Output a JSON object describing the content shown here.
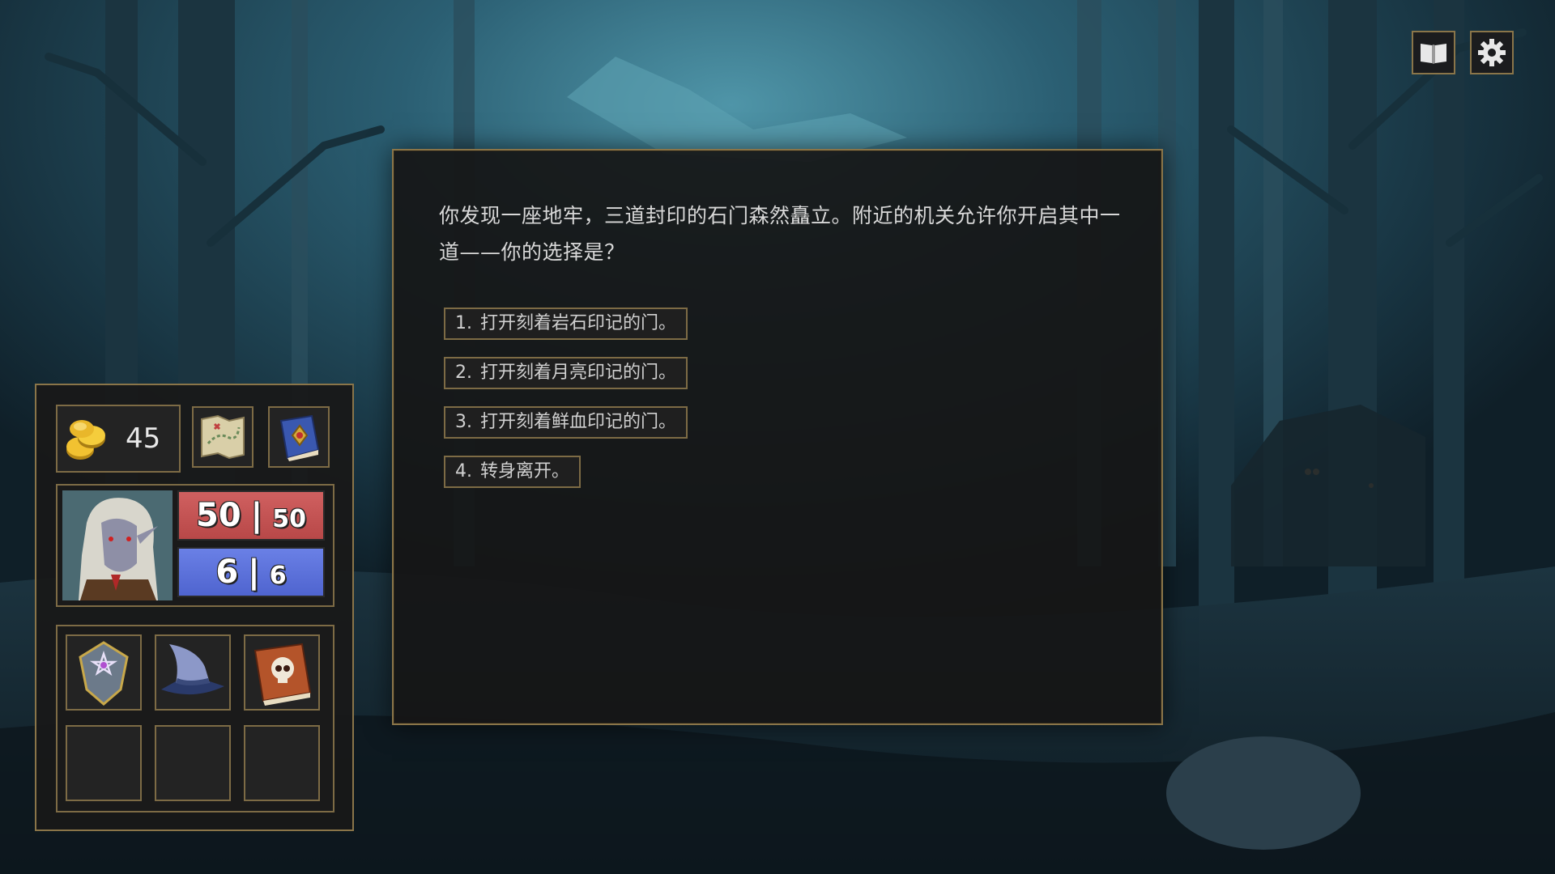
{
  "story": {
    "text": "你发现一座地牢，三道封印的石门森然矗立。附近的机关允许你开启其中一道——你的选择是？"
  },
  "choices": [
    {
      "num": "1.",
      "label": "打开刻着岩石印记的门。"
    },
    {
      "num": "2.",
      "label": "打开刻着月亮印记的门。"
    },
    {
      "num": "3.",
      "label": "打开刻着鲜血印记的门。"
    },
    {
      "num": "4.",
      "label": "转身离开。"
    }
  ],
  "hud": {
    "journal_icon": "book-icon",
    "settings_icon": "gear-icon"
  },
  "player": {
    "gold": "45",
    "hp_current": "50",
    "hp_max": "50",
    "mp_current": "6",
    "mp_max": "6",
    "separator": "|"
  },
  "inventory": {
    "quick_items": [
      "treasure-map-icon",
      "spellbook-icon"
    ],
    "equipment": [
      "pentagram-shield-icon",
      "wizard-hat-icon",
      "skull-tome-icon",
      "",
      "",
      ""
    ]
  },
  "colors": {
    "frame_gold": "#8a7549",
    "hp_red": "#c85454",
    "mp_blue": "#5a70dc"
  }
}
